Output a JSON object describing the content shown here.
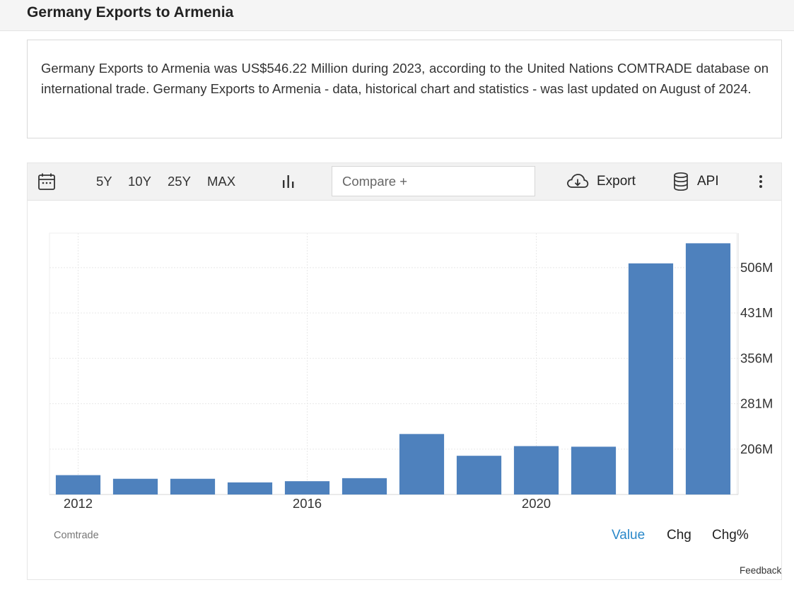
{
  "page": {
    "title": "Germany Exports to Armenia",
    "description": "Germany Exports to Armenia was US$546.22 Million during 2023, according to the United Nations COMTRADE database on international trade. Germany Exports to Armenia - data, historical chart and statistics - was last updated on August of 2024."
  },
  "toolbar": {
    "calendar_icon": "calendar-icon",
    "ranges": [
      "5Y",
      "10Y",
      "25Y",
      "MAX"
    ],
    "chart_type_icon": "bar-chart-icon",
    "compare_placeholder": "Compare +",
    "export_label": "Export",
    "export_icon": "cloud-download-icon",
    "api_label": "API",
    "api_icon": "database-icon",
    "more_icon": "more-vertical-icon"
  },
  "chart_data": {
    "type": "bar",
    "categories": [
      "2012",
      "2013",
      "2014",
      "2015",
      "2016",
      "2017",
      "2018",
      "2019",
      "2020",
      "2021",
      "2022",
      "2023"
    ],
    "values": [
      163,
      157,
      157,
      151,
      153,
      158,
      231,
      195,
      211,
      210,
      513,
      546.22
    ],
    "x_tick_labels": [
      "2012",
      "2016",
      "2020"
    ],
    "y_ticks": [
      206,
      281,
      356,
      431,
      506
    ],
    "y_tick_labels": [
      "206M",
      "281M",
      "356M",
      "431M",
      "506M"
    ],
    "ylim": [
      131,
      563
    ],
    "y_axis_position": "right",
    "grid": true,
    "bar_color": "#4e81bd",
    "unit": "US$ Million"
  },
  "footer": {
    "source": "Comtrade",
    "tabs": [
      "Value",
      "Chg",
      "Chg%"
    ],
    "active_tab": "Value",
    "feedback": "Feedback"
  },
  "colors": {
    "accent": "#2a88c9",
    "bar": "#4e81bd",
    "header_bg": "#f5f5f5"
  }
}
